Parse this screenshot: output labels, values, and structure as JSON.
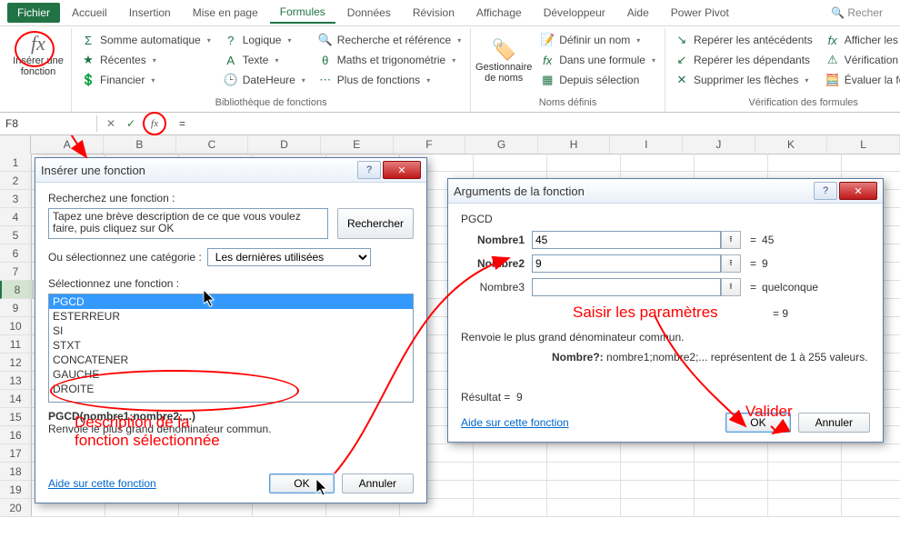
{
  "accent": "#217346",
  "ribbon_tabs": [
    "Fichier",
    "Accueil",
    "Insertion",
    "Mise en page",
    "Formules",
    "Données",
    "Révision",
    "Affichage",
    "Développeur",
    "Aide",
    "Power Pivot",
    "Recher"
  ],
  "ribbon_active": "Formules",
  "insert_fn": {
    "label": "Insérer une\nfonction"
  },
  "lib": {
    "sum": "Somme automatique",
    "recent": "Récentes",
    "financial": "Financier",
    "logic": "Logique",
    "text": "Texte",
    "datetime": "DateHeure",
    "lookup": "Recherche et référence",
    "math": "Maths et trigonométrie",
    "more": "Plus de fonctions",
    "group": "Bibliothèque de fonctions"
  },
  "names": {
    "manager": "Gestionnaire\nde noms",
    "define": "Définir un nom",
    "useinf": "Dans une formule",
    "fromsel": "Depuis sélection",
    "group": "Noms définis"
  },
  "audit": {
    "prec": "Repérer les antécédents",
    "dep": "Repérer les dépendants",
    "remarr": "Supprimer les flèches",
    "showf": "Afficher les formu",
    "errchk": "Vérification des er",
    "eval": "Évaluer la formule",
    "group": "Vérification des formules"
  },
  "fbar": {
    "name": "F8",
    "text": "="
  },
  "cols": [
    "A",
    "B",
    "C",
    "D",
    "E",
    "F",
    "G",
    "H",
    "I",
    "J",
    "K",
    "L"
  ],
  "rows": [
    "1",
    "2",
    "3",
    "4",
    "5",
    "6",
    "7",
    "8",
    "9",
    "10",
    "11",
    "12",
    "13",
    "14",
    "15",
    "16",
    "17",
    "18",
    "19",
    "20"
  ],
  "dlg_insert": {
    "title": "Insérer une fonction",
    "search_lbl": "Recherchez une fonction :",
    "search_text": "Tapez une brève description de ce que vous voulez faire, puis cliquez sur OK",
    "search_btn": "Rechercher",
    "cat_lbl": "Ou sélectionnez une catégorie :",
    "cat_val": "Les dernières utilisées",
    "select_lbl": "Sélectionnez une fonction :",
    "functions": [
      "PGCD",
      "ESTERREUR",
      "SI",
      "STXT",
      "CONCATENER",
      "GAUCHE",
      "DROITE"
    ],
    "selected": "PGCD",
    "sig": "PGCD(nombre1;nombre2;...)",
    "desc": "Renvoie le plus grand dénominateur commun.",
    "help": "Aide sur cette fonction",
    "ok": "OK",
    "cancel": "Annuler"
  },
  "dlg_args": {
    "title": "Arguments de la fonction",
    "func": "PGCD",
    "arg1_lbl": "Nombre1",
    "arg1_val": "45",
    "arg1_res": "45",
    "arg2_lbl": "Nombre2",
    "arg2_val": "9",
    "arg2_res": "9",
    "arg3_lbl": "Nombre3",
    "arg3_val": "",
    "arg3_res": "quelconque",
    "preview": "=  9",
    "desc1": "Renvoie le plus grand dénominateur commun.",
    "desc2_lbl": "Nombre?:",
    "desc2": "nombre1;nombre2;... représentent de 1 à 255 valeurs.",
    "result_lbl": "Résultat =",
    "result": "9",
    "help": "Aide sur cette fonction",
    "ok": "OK",
    "cancel": "Annuler"
  },
  "annot": {
    "params": "Saisir les paramètres",
    "desc": "Description de la\nfonction sélectionnée",
    "validate": "Valider"
  }
}
